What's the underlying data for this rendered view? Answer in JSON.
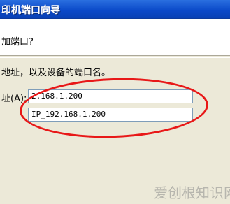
{
  "window": {
    "title": "印机端口向导"
  },
  "header": {
    "question": "加端口?"
  },
  "form": {
    "instruction": "地址，以及设备的端口名。",
    "ip_label": "址(A):",
    "ip_value": "2.168.1.200",
    "port_name_value": "IP_192.168.1.200"
  },
  "watermark": {
    "text": "爱创根知识网"
  },
  "colors": {
    "annotation": "#e81818",
    "title_bar": "#0a48c8"
  }
}
